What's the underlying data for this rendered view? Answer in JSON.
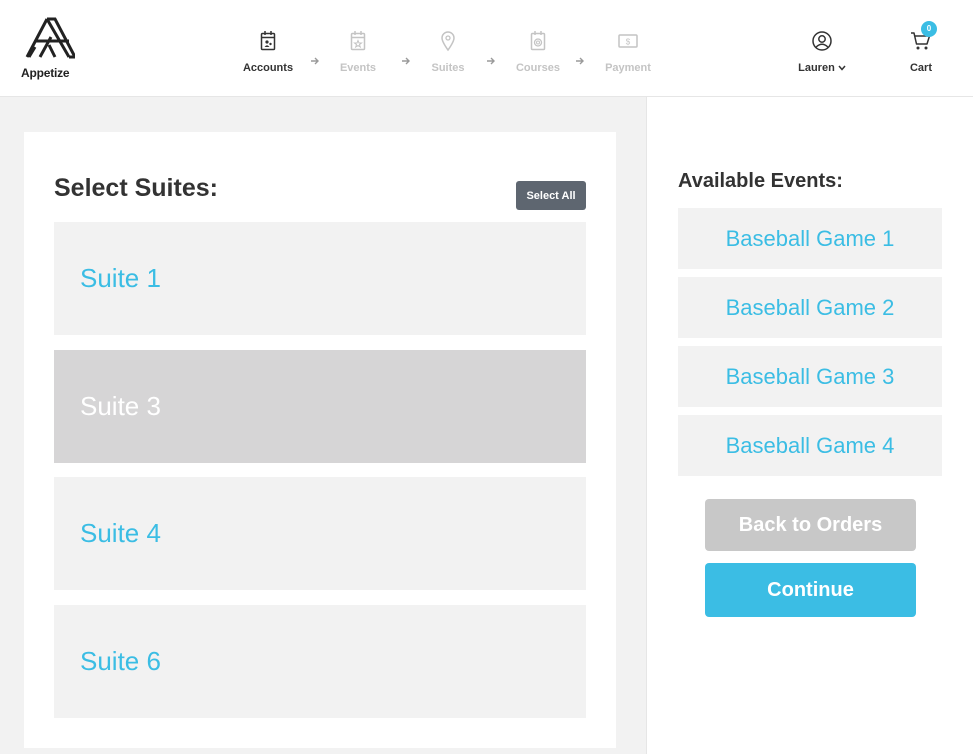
{
  "brand": {
    "name": "Appetize"
  },
  "steps": [
    {
      "label": "Accounts",
      "icon": "calendar-account-icon",
      "active": true
    },
    {
      "label": "Events",
      "icon": "calendar-star-icon",
      "active": false
    },
    {
      "label": "Suites",
      "icon": "location-pin-icon",
      "active": false
    },
    {
      "label": "Courses",
      "icon": "dish-icon",
      "active": false
    },
    {
      "label": "Payment",
      "icon": "dollar-bill-icon",
      "active": false
    }
  ],
  "user": {
    "name": "Lauren",
    "icon": "user-circle-icon"
  },
  "cart": {
    "label": "Cart",
    "count": "0",
    "icon": "cart-icon"
  },
  "suites_panel": {
    "title": "Select Suites:",
    "select_all_label": "Select All",
    "suites": [
      {
        "label": "Suite 1",
        "selected": false
      },
      {
        "label": "Suite 3",
        "selected": true
      },
      {
        "label": "Suite 4",
        "selected": false
      },
      {
        "label": "Suite 6",
        "selected": false
      }
    ]
  },
  "events_panel": {
    "title": "Available Events:",
    "events": [
      {
        "label": "Baseball Game 1"
      },
      {
        "label": "Baseball Game 2"
      },
      {
        "label": "Baseball Game 3"
      },
      {
        "label": "Baseball Game 4"
      }
    ],
    "back_label": "Back to Orders",
    "continue_label": "Continue"
  },
  "colors": {
    "accent": "#3bbde4",
    "selected_bg": "#d6d5d6",
    "button_dark": "#5e6670",
    "button_disabled": "#c8c8c8"
  }
}
